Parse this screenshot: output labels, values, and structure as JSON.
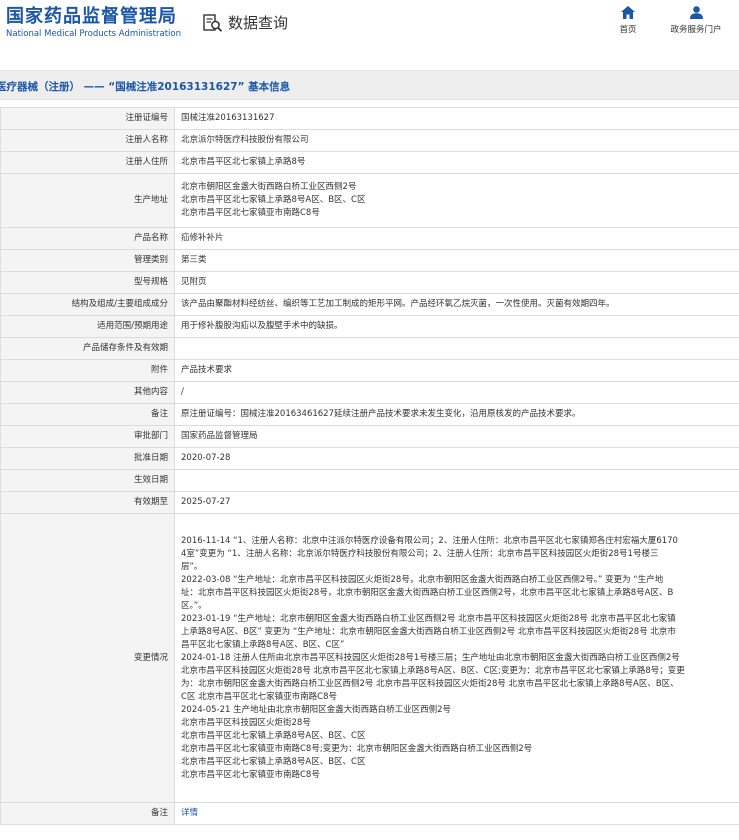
{
  "header": {
    "logo_cn": "国家药品监督管理局",
    "logo_en": "National Medical Products Administration",
    "query_title": "数据查询",
    "nav": [
      {
        "label": "首页",
        "icon": "home-icon"
      },
      {
        "label": "政务服务门户",
        "icon": "user-icon"
      }
    ]
  },
  "title": "医疗器械（注册） —— “国械注准20163131627” 基本信息",
  "rows": [
    {
      "label": "注册证编号",
      "lines": [
        "国械注准20163131627"
      ]
    },
    {
      "label": "注册人名称",
      "lines": [
        "北京派尔特医疗科技股份有限公司"
      ]
    },
    {
      "label": "注册人住所",
      "lines": [
        "北京市昌平区北七家镇上承路8号"
      ]
    },
    {
      "label": "生产地址",
      "lines": [
        "北京市朝阳区金盏大街西路白桥工业区西侧2号",
        "北京市昌平区北七家镇上承路8号A区、B区、C区",
        "北京市昌平区北七家镇亚市南路C8号"
      ]
    },
    {
      "label": "产品名称",
      "lines": [
        "疝修补补片"
      ]
    },
    {
      "label": "管理类别",
      "lines": [
        "第三类"
      ]
    },
    {
      "label": "型号规格",
      "lines": [
        "见附页"
      ]
    },
    {
      "label": "结构及组成/主要组成成分",
      "lines": [
        "该产品由聚酯材料经纺丝、编织等工艺加工制成的矩形平网。产品经环氧乙烷灭菌，一次性使用。灭菌有效期四年。"
      ]
    },
    {
      "label": "适用范围/预期用途",
      "lines": [
        "用于修补腹股沟疝以及腹壁手术中的缺损。"
      ]
    },
    {
      "label": "产品储存条件及有效期",
      "lines": []
    },
    {
      "label": "附件",
      "lines": [
        "产品技术要求"
      ]
    },
    {
      "label": "其他内容",
      "lines": [
        "/"
      ]
    },
    {
      "label": "备注",
      "lines": [
        "原注册证编号：国械注准20163461627延续注册产品技术要求未发生变化，沿用原核发的产品技术要求。"
      ]
    },
    {
      "label": "审批部门",
      "lines": [
        "国家药品监督管理局"
      ]
    },
    {
      "label": "批准日期",
      "lines": [
        "2020-07-28"
      ]
    },
    {
      "label": "生效日期",
      "lines": []
    },
    {
      "label": "有效期至",
      "lines": [
        "2025-07-27"
      ]
    },
    {
      "label": "变更情况",
      "lines": [
        "2016-11-14 “1、注册人名称：北京中注派尔特医疗设备有限公司；2、注册人住所：北京市昌平区北七家镇郑各庄村宏福大厦6170",
        "4室”变更为 “1、注册人名称：北京派尔特医疗科技股份有限公司；2、注册人住所：北京市昌平区科技园区火炬街28号1号楼三",
        "层”。",
        "2022-03-08 “生产地址：北京市昌平区科技园区火炬街28号，北京市朝阳区金盏大街西路白桥工业区西侧2号。” 变更为 “生产地",
        "址：北京市昌平区科技园区火炬街28号，北京市朝阳区金盏大街西路白桥工业区西侧2号，北京市昌平区北七家镇上承路8号A区、B",
        "区。”。",
        "2023-01-19 “生产地址：北京市朝阳区金盏大街西路白桥工业区西侧2号 北京市昌平区科技园区火炬街28号 北京市昌平区北七家镇",
        "上承路8号A区、B区” 变更为 “生产地址：北京市朝阳区金盏大街西路白桥工业区西侧2号 北京市昌平区科技园区火炬街28号 北京市",
        "昌平区北七家镇上承路8号A区、B区、C区”",
        "2024-01-18 注册人住所由北京市昌平区科技园区火炬街28号1号楼三层；生产地址由北京市朝阳区金盏大街西路白桥工业区西侧2号",
        "北京市昌平区科技园区火炬街28号 北京市昌平区北七家镇上承路8号A区、B区、C区;变更为：北京市昌平区北七家镇上承路8号；变更",
        "为：北京市朝阳区金盏大街西路白桥工业区西侧2号 北京市昌平区科技园区火炬街28号 北京市昌平区北七家镇上承路8号A区、B区、",
        "C区 北京市昌平区北七家镇亚市南路C8号",
        "2024-05-21 生产地址由北京市朝阳区金盏大街西路白桥工业区西侧2号",
        "北京市昌平区科技园区火炬街28号",
        "北京市昌平区北七家镇上承路8号A区、B区、C区",
        "北京市昌平区北七家镇亚市南路C8号;变更为：北京市朝阳区金盏大街西路白桥工业区西侧2号",
        "北京市昌平区北七家镇上承路8号A区、B区、C区",
        "北京市昌平区北七家镇亚市南路C8号"
      ]
    },
    {
      "label": "备注",
      "lines": [
        "详情"
      ],
      "link": true
    }
  ]
}
